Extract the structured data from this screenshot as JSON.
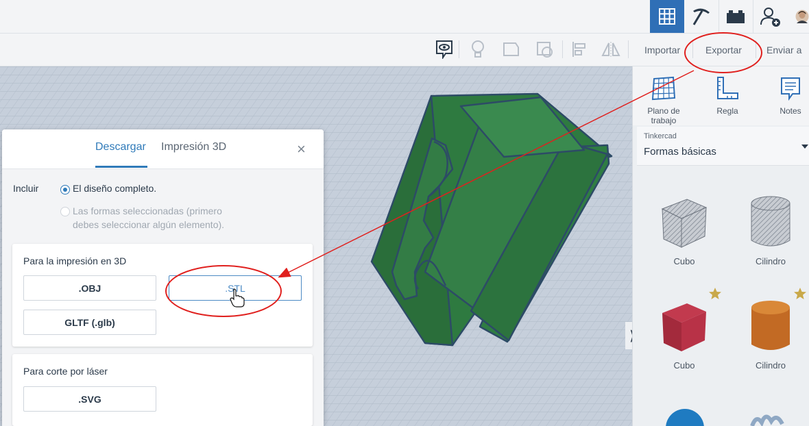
{
  "topbar": {
    "buttons": [
      {
        "name": "grid-view-icon",
        "active": true
      },
      {
        "name": "pickaxe-icon",
        "active": false
      },
      {
        "name": "brick-icon",
        "active": false
      },
      {
        "name": "add-user-icon",
        "active": false
      },
      {
        "name": "user-avatar",
        "active": false
      }
    ]
  },
  "toolbar": {
    "tools": [
      "comment-icon",
      "bulb-icon",
      "note-shape-icon",
      "shape-select-icon",
      "align-icon",
      "mirror-icon"
    ],
    "import_label": "Importar",
    "export_label": "Exportar",
    "send_label": "Enviar a"
  },
  "right_panel": {
    "workplane_label": "Plano de trabajo",
    "ruler_label": "Regla",
    "notes_label": "Notes",
    "library_small": "Tinkercad",
    "library_name": "Formas básicas",
    "shapes": [
      {
        "label": "Cubo",
        "icon": "cube-hole-icon"
      },
      {
        "label": "Cilindro",
        "icon": "cylinder-hole-icon"
      },
      {
        "label": "Cubo",
        "icon": "cube-red-icon",
        "starred": true
      },
      {
        "label": "Cilindro",
        "icon": "cylinder-orange-icon",
        "starred": true
      }
    ]
  },
  "dialog": {
    "tab_download": "Descargar",
    "tab_print": "Impresión 3D",
    "close_symbol": "×",
    "include_label": "Incluir",
    "option_full": "El diseño completo.",
    "option_selected_line1": "Las formas seleccionadas (primero",
    "option_selected_line2": "debes seleccionar algún elemento).",
    "print_section_title": "Para la impresión en 3D",
    "btn_obj": ".OBJ",
    "btn_stl": ".STL",
    "btn_gltf": "GLTF (.glb)",
    "laser_section_title": "Para corte por láser",
    "btn_svg": ".SVG"
  },
  "colors": {
    "accent": "#2f7ab9",
    "model_green": "#2f7a3e",
    "annotation_red": "#e0201e"
  }
}
